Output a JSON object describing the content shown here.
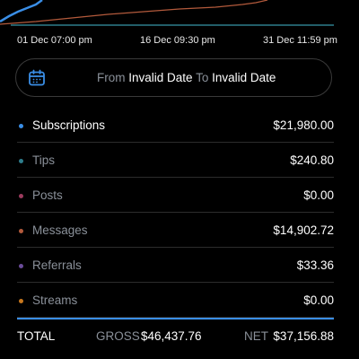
{
  "chart_data": {
    "type": "line",
    "x_tick_labels": [
      "01 Dec 07:00 pm",
      "16 Dec 09:30 pm",
      "31 Dec 11:59 pm"
    ],
    "series": [
      {
        "color": "#3a8ee6"
      },
      {
        "color": "#b35a3c"
      },
      {
        "color": "#2e7d8c"
      }
    ]
  },
  "date_range": {
    "from_label": "From",
    "from_value": "Invalid Date",
    "to_label": "To",
    "to_value": "Invalid Date",
    "icon": "calendar-icon"
  },
  "categories": [
    {
      "label": "Subscriptions",
      "amount": "$21,980.00",
      "dot_color": "#3a8ee6",
      "label_color": "#ffffff"
    },
    {
      "label": "Tips",
      "amount": "$240.80",
      "dot_color": "#2e7d8c",
      "label_color": "#8a9099"
    },
    {
      "label": "Posts",
      "amount": "$0.00",
      "dot_color": "#9c3b5e",
      "label_color": "#8a9099"
    },
    {
      "label": "Messages",
      "amount": "$14,902.72",
      "dot_color": "#b35a3c",
      "label_color": "#8a9099"
    },
    {
      "label": "Referrals",
      "amount": "$33.36",
      "dot_color": "#6b4c9a",
      "label_color": "#8a9099"
    },
    {
      "label": "Streams",
      "amount": "$0.00",
      "dot_color": "#c8781e",
      "label_color": "#8a9099"
    }
  ],
  "totals": {
    "label": "TOTAL",
    "gross_label": "GROSS",
    "gross_value": "$46,437.76",
    "net_label": "NET",
    "net_value": "$37,156.88",
    "divider_color": "#3a8ee6"
  }
}
